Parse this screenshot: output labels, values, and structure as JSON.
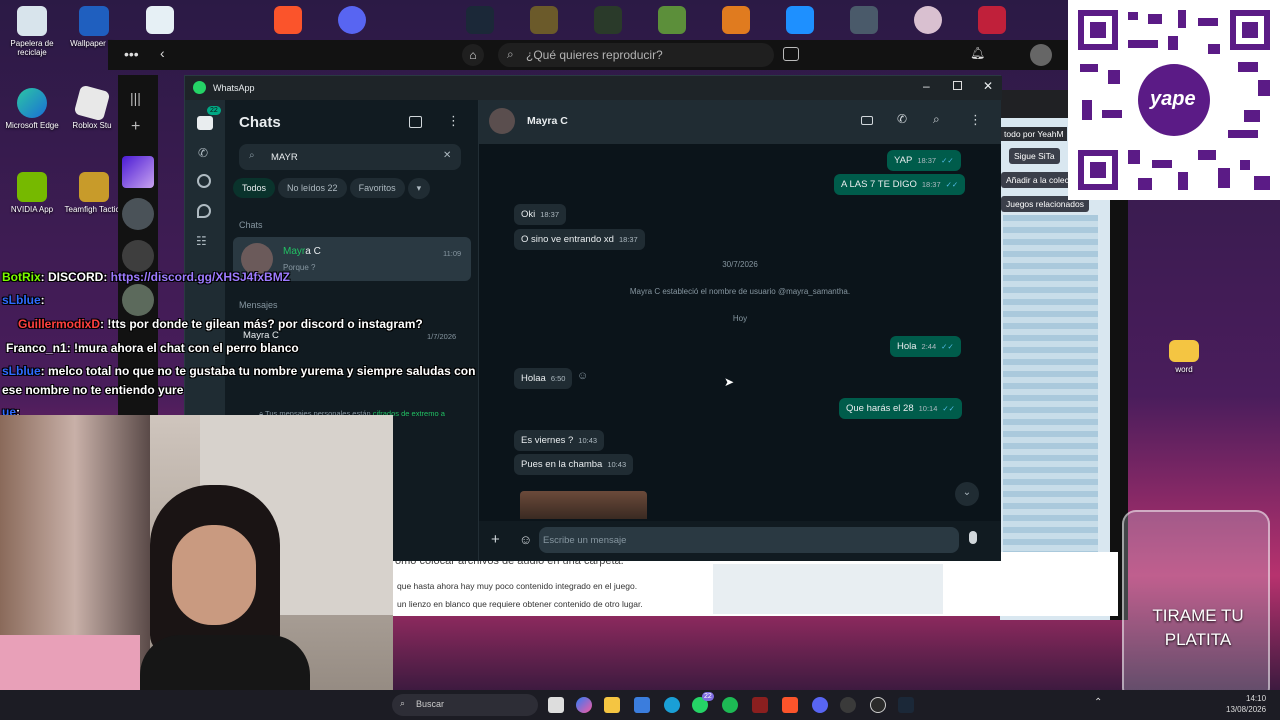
{
  "desktop": {
    "icons": [
      {
        "label": "Papelera de reciclaje"
      },
      {
        "label": "Wallpaper En"
      },
      {
        "label": "Microsoft Edge"
      },
      {
        "label": "Roblox Stu"
      },
      {
        "label": "NVIDIA App"
      },
      {
        "label": "Teamfigh Tactics"
      },
      {
        "label": "word"
      }
    ]
  },
  "music_app": {
    "search_placeholder": "¿Qué quieres reproducir?"
  },
  "right_browser": {
    "follow_label": "Sigue SiTa",
    "add_collection": "Añadir a la colec",
    "related_games": "Juegos relacionados",
    "todo_por": "todo por YeahM"
  },
  "background_doc": {
    "heading": "omo colocar archivos de audio en una carpeta.",
    "line1": "que hasta ahora hay muy poco contenido integrado en el juego.",
    "line2": "un lienzo en blanco que requiere obtener contenido de otro lugar."
  },
  "whatsapp": {
    "window_title": "WhatsApp",
    "rail_badge": "22",
    "chats_title": "Chats",
    "search_value": "MAYR",
    "filters": [
      "Todos",
      "No leídos 22",
      "Favoritos"
    ],
    "section_chats": "Chats",
    "result_name_highlight": "Mayr",
    "result_name_rest": "a C",
    "result_preview": "Porque ?",
    "result_time": "11:09",
    "section_messages": "Mensajes",
    "message_result_name": "Mayra C",
    "message_result_date": "1/7/2026",
    "encryption_text": "Tus mensajes personales están",
    "encryption_link": "cifrados de extremo a extremo.",
    "contact_name": "Mayra C",
    "composer_placeholder": "Escribe un mensaje",
    "messages": [
      {
        "dir": "out",
        "text": "YAP",
        "time": "18:37"
      },
      {
        "dir": "out",
        "text": "A LAS 7 TE DIGO",
        "time": "18:37"
      },
      {
        "dir": "in",
        "text": "Oki",
        "time": "18:37"
      },
      {
        "dir": "in",
        "text": "O sino ve entrando xd",
        "time": "18:37"
      },
      {
        "dir": "out",
        "text": "Hola",
        "time": "2:44"
      },
      {
        "dir": "in",
        "text": "Holaa",
        "time": "6:50"
      },
      {
        "dir": "out",
        "text": "Que harás el 28",
        "time": "10:14"
      },
      {
        "dir": "in",
        "text": "Es viernes ?",
        "time": "10:43"
      },
      {
        "dir": "in",
        "text": "Pues en la chamba",
        "time": "10:43"
      }
    ],
    "date_divider_1": "30/7/2026",
    "system_message": "Mayra C estableció el nombre de usuario @mayra_samantha.",
    "date_divider_2": "Hoy"
  },
  "stream_chat": [
    {
      "user": "BotRix",
      "text": ": DISCORD: ",
      "link": "https://discord.gg/XHSJ4fxBMZ",
      "color": "#7cfc00"
    },
    {
      "user": "sLblue",
      "text": ":",
      "link": "",
      "color": "#2f6bff"
    },
    {
      "user": "GuillermodixD",
      "text": ": !tts por donde te gilean más? por discord o instagram?",
      "link": "",
      "color": "#ff4040"
    },
    {
      "user": "Franco_n1",
      "text": ": !mura ahora el chat con el perro blanco",
      "link": "",
      "color": "#ffffff"
    },
    {
      "user": "sLblue",
      "text": ": melco total no que no te gustaba tu nombre yurema y siempre saludas con",
      "link": "",
      "color": "#2f6bff"
    },
    {
      "user": "",
      "text": "ese nombre no te entiendo yure",
      "link": "",
      "color": "#ffffff"
    },
    {
      "user": "ue",
      "text": ":",
      "link": "",
      "color": "#2f6bff"
    }
  ],
  "jar_text": "TIRAME TU PLATITA",
  "qr_brand": "yape",
  "taskbar": {
    "search": "Buscar",
    "badge_whatsapp": "22",
    "time": "14:10",
    "date": "13/08/2026"
  }
}
